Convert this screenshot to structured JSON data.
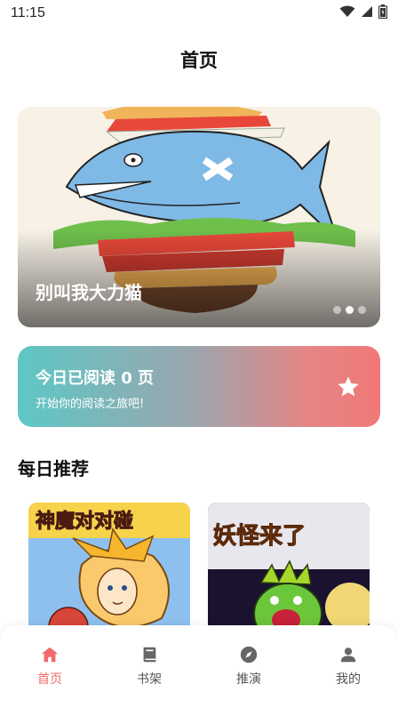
{
  "status_bar": {
    "time": "11:15"
  },
  "header": {
    "title": "首页"
  },
  "banner": {
    "title": "别叫我大力猫",
    "dots": 3,
    "active_dot": 1
  },
  "reading": {
    "title": "今日已阅读 0 页",
    "subtitle": "开始你的阅读之旅吧!",
    "icon": "star-icon"
  },
  "daily": {
    "title": "每日推荐",
    "cards": [
      {
        "cover_text": "神魔对对碰"
      },
      {
        "cover_text": "妖怪来了"
      }
    ]
  },
  "tabs": [
    {
      "label": "首页",
      "icon": "home-icon",
      "active": true
    },
    {
      "label": "书架",
      "icon": "book-icon",
      "active": false
    },
    {
      "label": "推演",
      "icon": "compass-icon",
      "active": false
    },
    {
      "label": "我的",
      "icon": "user-icon",
      "active": false
    }
  ],
  "colors": {
    "accent": "#f06b6b",
    "card_gradient_start": "#5ec7c5",
    "card_gradient_end": "#f17777"
  }
}
